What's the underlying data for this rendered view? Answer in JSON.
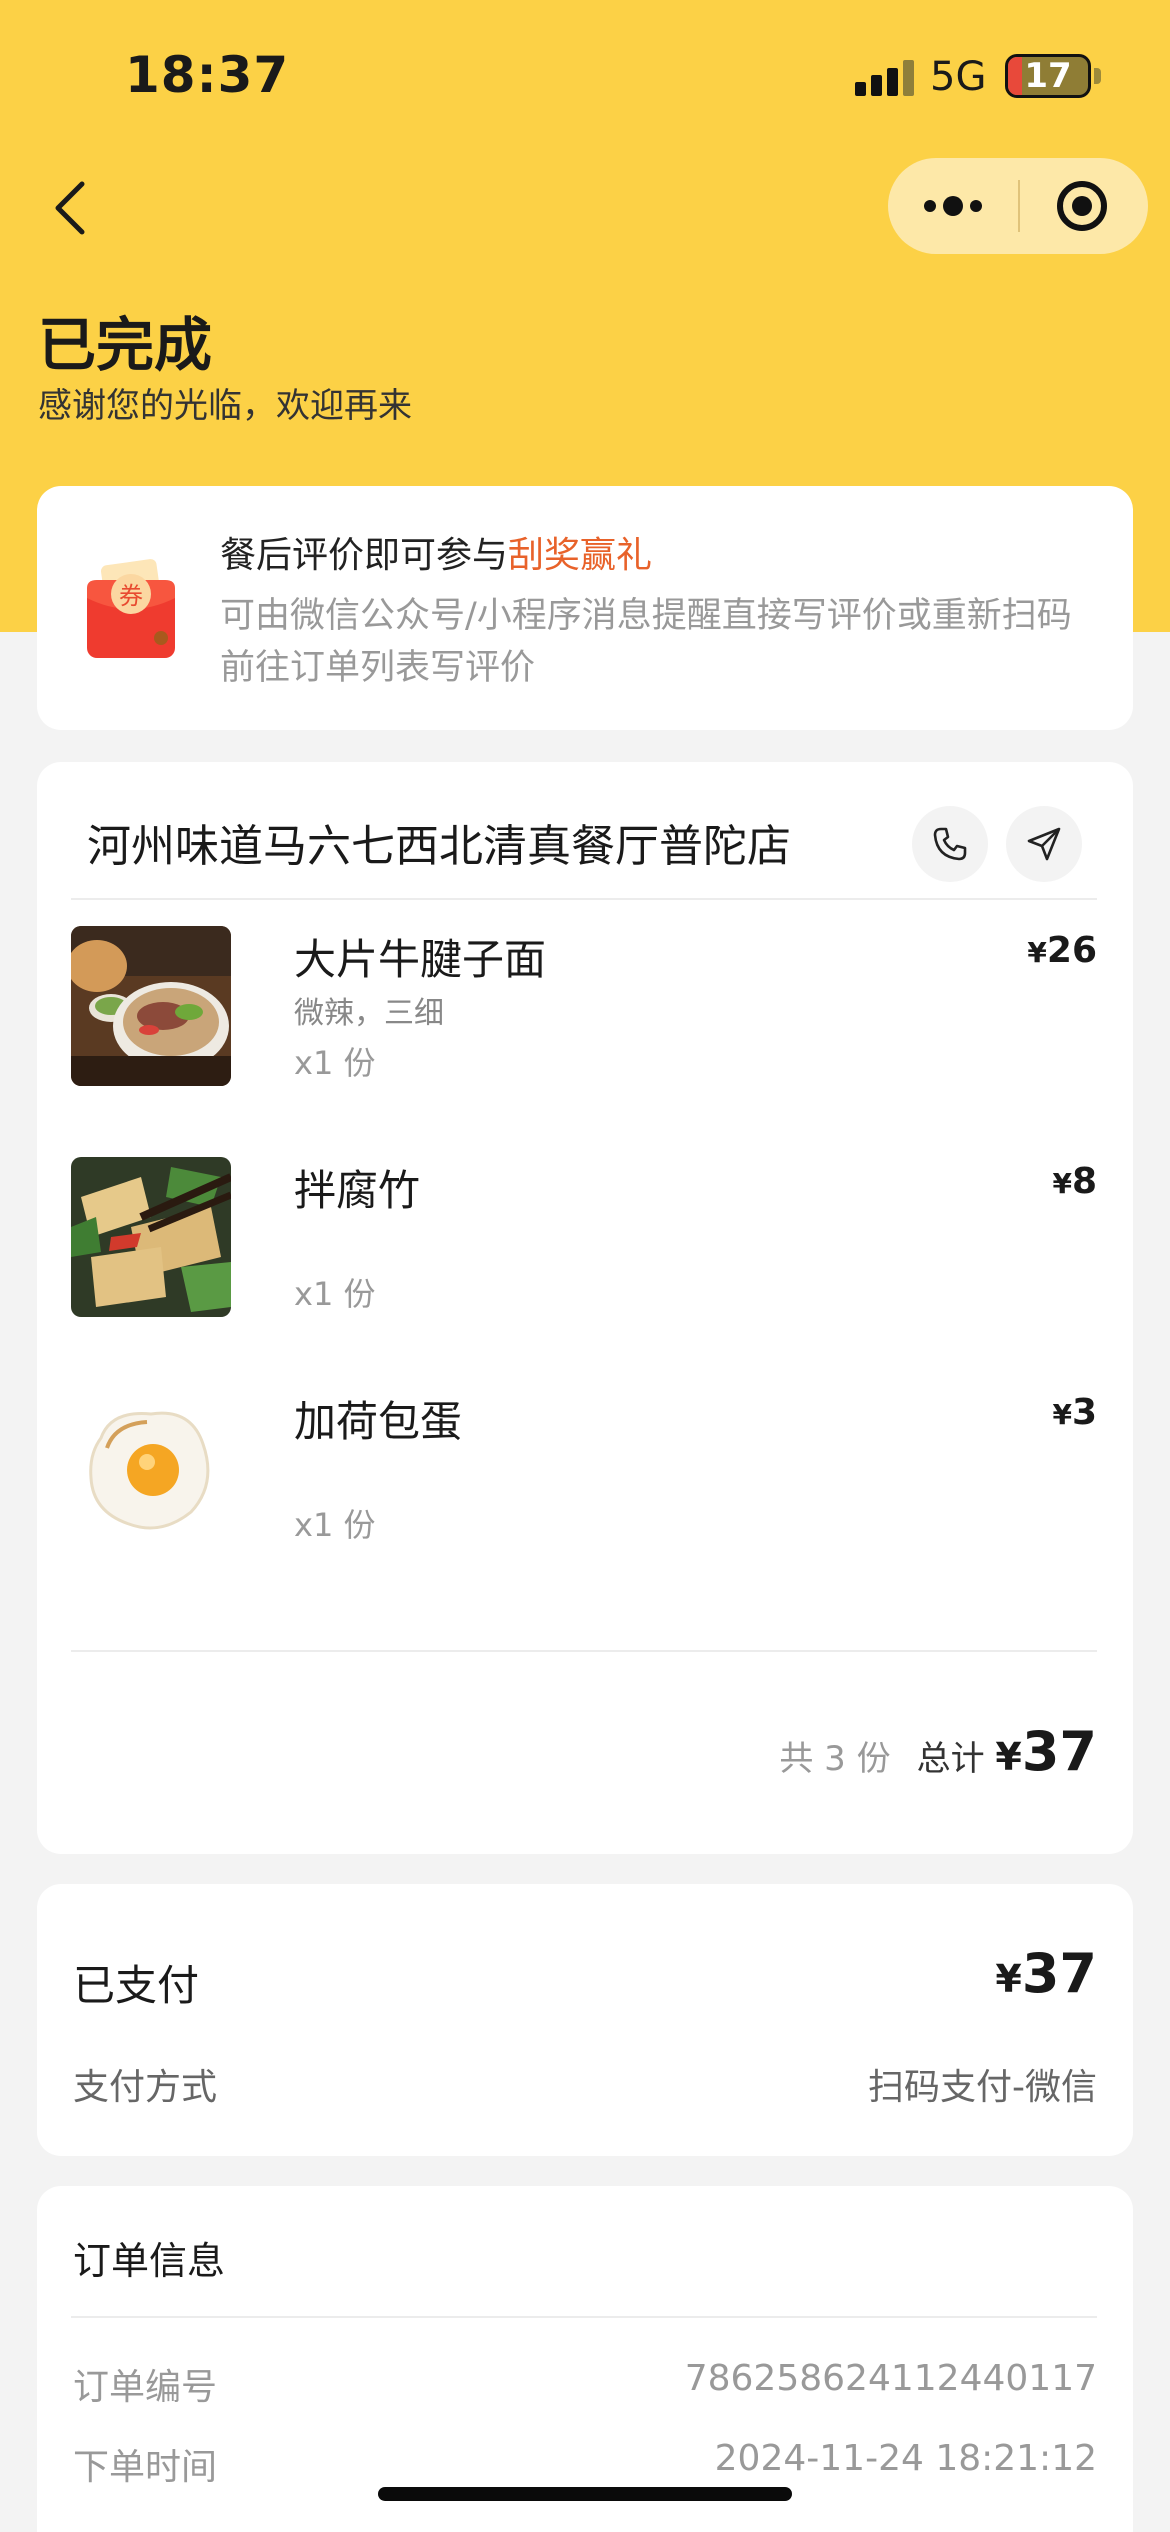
{
  "status_bar": {
    "time": "18:37",
    "network": "5G",
    "battery": "17",
    "battery_level": 0.17
  },
  "header": {
    "back_icon": "chevron-left-icon",
    "more_icon": "more-dots-icon",
    "close_icon": "mini-program-close-icon",
    "title": "已完成",
    "subtitle": "感谢您的光临，欢迎再来"
  },
  "promo": {
    "icon": "red-packet-coupon-icon",
    "icon_text": "券",
    "title_prefix": "餐后评价即可参与",
    "title_accent": "刮奖赢礼",
    "description": "可由微信公众号/小程序消息提醒直接写评价或重新扫码前往订单列表写评价"
  },
  "order": {
    "store_name": "河州味道马六七西北清真餐厅普陀店",
    "phone_icon": "phone-icon",
    "navigate_icon": "navigation-arrow-icon",
    "items": [
      {
        "name": "大片牛腱子面",
        "spec": "微辣，三细",
        "qty": "x1 份",
        "currency": "¥",
        "price": "26",
        "image": "beef-noodle-photo"
      },
      {
        "name": "拌腐竹",
        "spec": "",
        "qty": "x1 份",
        "currency": "¥",
        "price": "8",
        "image": "tofu-skin-salad-photo"
      },
      {
        "name": "加荷包蛋",
        "spec": "",
        "qty": "x1 份",
        "currency": "¥",
        "price": "3",
        "image": "fried-egg-photo"
      }
    ],
    "count_text": "共 3 份",
    "total_label": "总计",
    "total_currency": "¥",
    "total_amount": "37"
  },
  "payment": {
    "paid_label": "已支付",
    "currency": "¥",
    "paid_amount": "37",
    "method_label": "支付方式",
    "method_value": "扫码支付-微信"
  },
  "order_info": {
    "title": "订单信息",
    "rows": [
      {
        "label": "订单编号",
        "value": "786258624112440117"
      },
      {
        "label": "下单时间",
        "value": "2024-11-24 18:21:12"
      }
    ]
  },
  "colors": {
    "header_yellow": "#fcd146",
    "accent_orange": "#e8622a",
    "page_bg": "#f3f3f3"
  }
}
